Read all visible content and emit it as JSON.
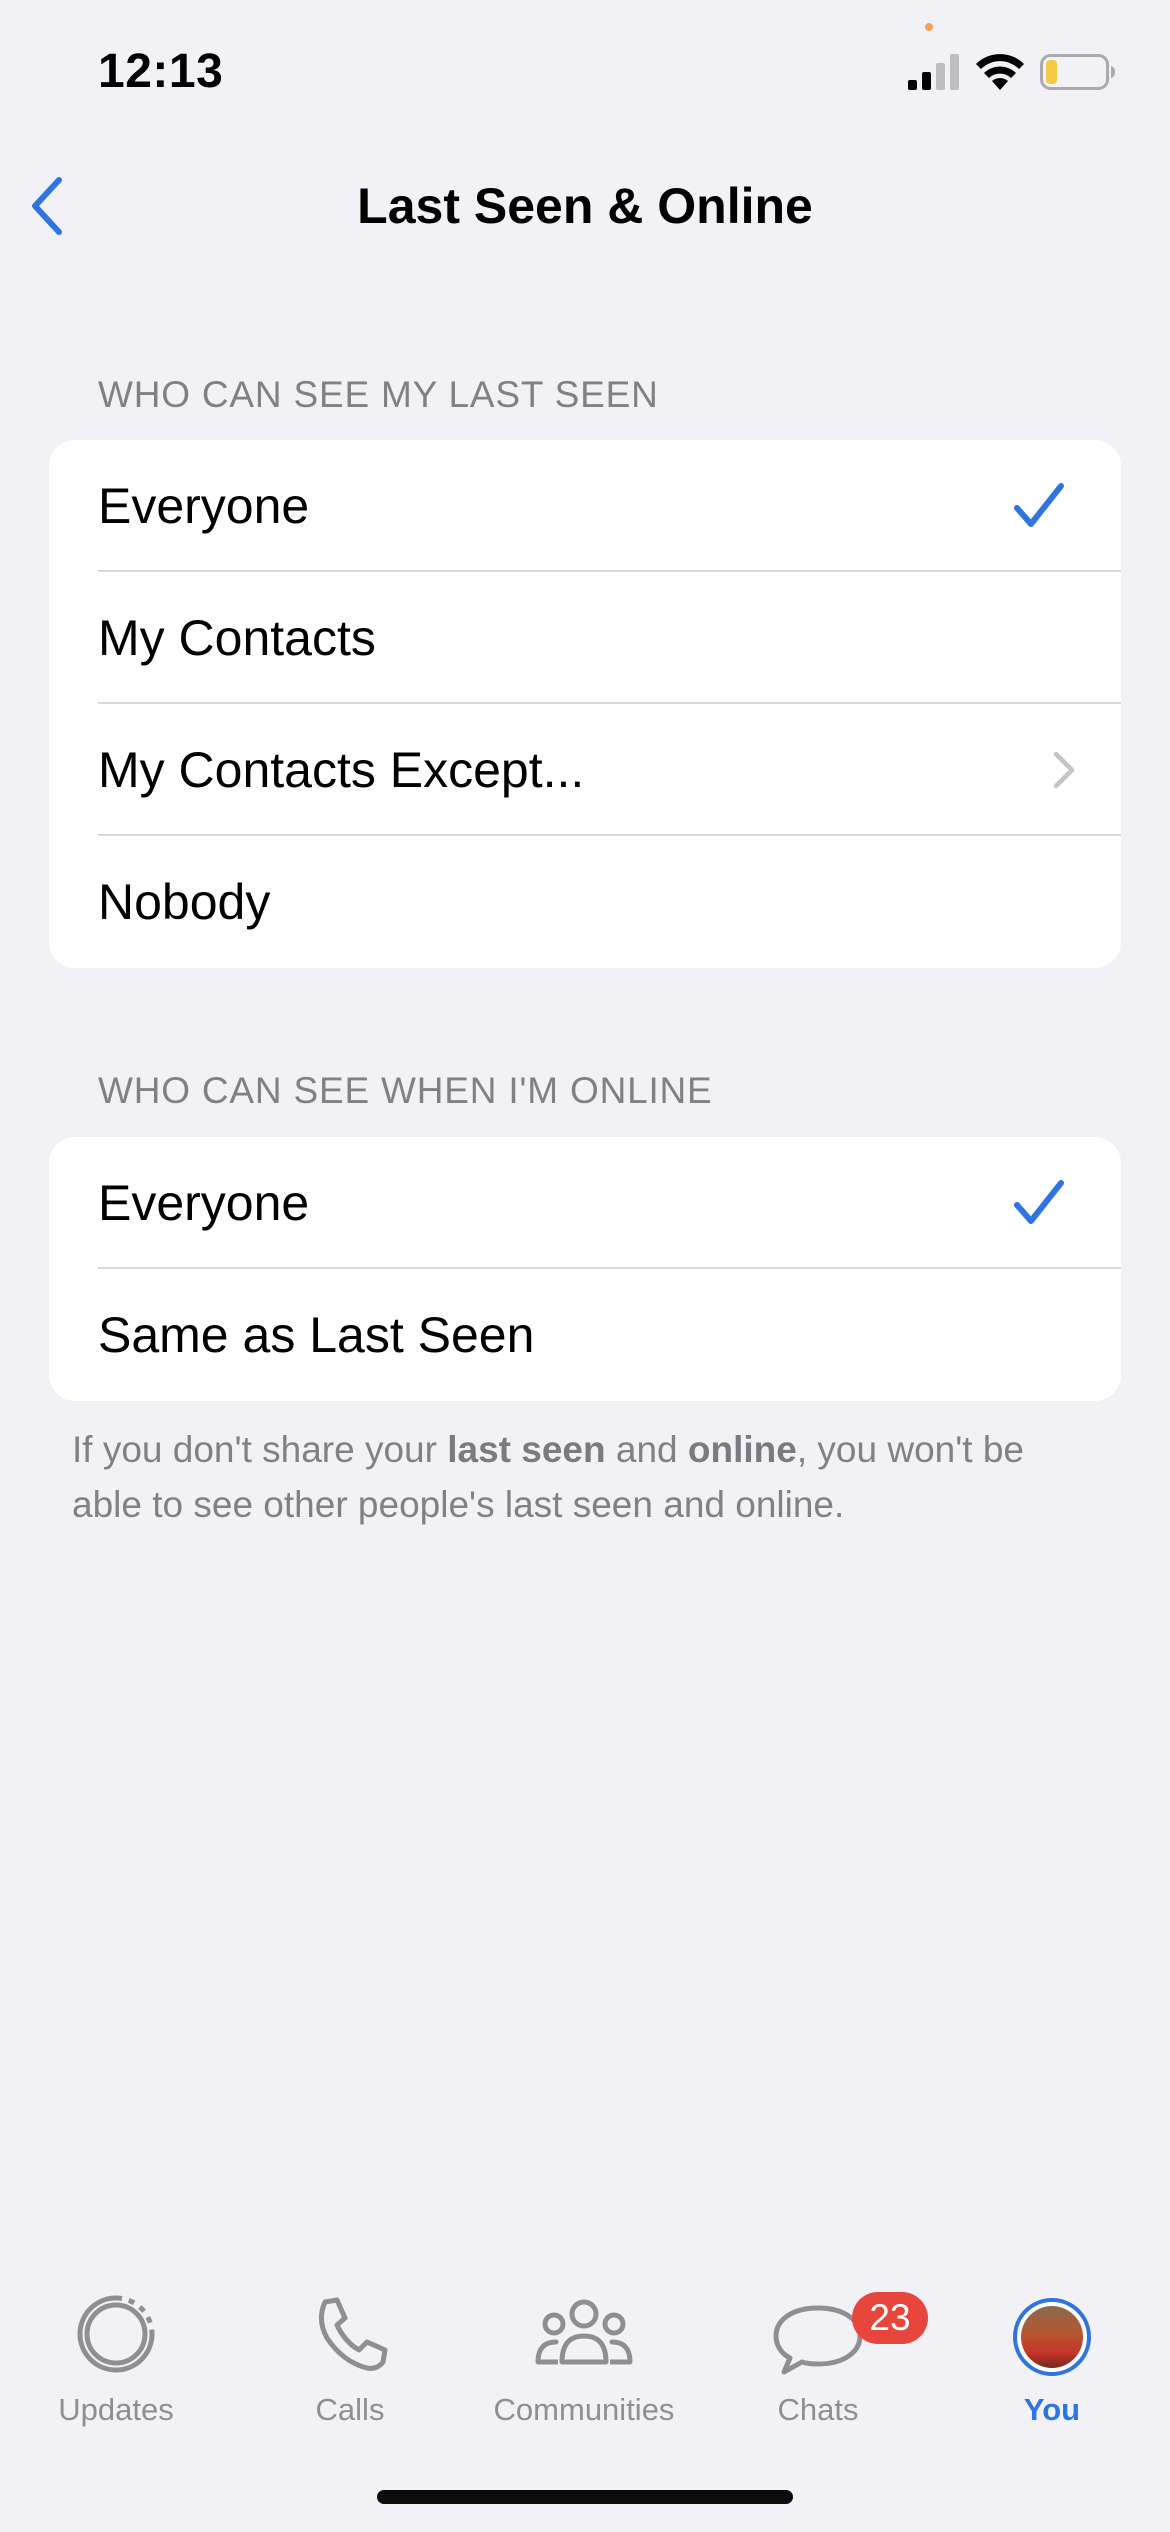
{
  "status_bar": {
    "time": "12:13",
    "signal_icon": "cellular-signal-icon",
    "wifi_icon": "wifi-icon",
    "battery_icon": "battery-low-icon",
    "battery_level": 0.2,
    "battery_color": "#f6c945"
  },
  "nav": {
    "title": "Last Seen & Online",
    "back_icon": "chevron-left-icon"
  },
  "sections": {
    "last_seen": {
      "header": "WHO CAN SEE MY LAST SEEN",
      "options": [
        {
          "label": "Everyone",
          "selected": true
        },
        {
          "label": "My Contacts",
          "selected": false
        },
        {
          "label": "My Contacts Except...",
          "selected": false,
          "has_chevron": true
        },
        {
          "label": "Nobody",
          "selected": false
        }
      ]
    },
    "online": {
      "header": "WHO CAN SEE WHEN I'M ONLINE",
      "options": [
        {
          "label": "Everyone",
          "selected": true
        },
        {
          "label": "Same as Last Seen",
          "selected": false
        }
      ]
    }
  },
  "footnote": {
    "part1": "If you don't share your ",
    "bold1": "last seen",
    "part2": " and ",
    "bold2": "online",
    "part3": ", you won't be able to see other people's last seen and online."
  },
  "tabs": [
    {
      "label": "Updates",
      "icon": "updates-icon",
      "active": false
    },
    {
      "label": "Calls",
      "icon": "phone-icon",
      "active": false
    },
    {
      "label": "Communities",
      "icon": "communities-icon",
      "active": false
    },
    {
      "label": "Chats",
      "icon": "chats-icon",
      "active": false,
      "badge": "23"
    },
    {
      "label": "You",
      "icon": "avatar",
      "active": true
    }
  ],
  "colors": {
    "accent": "#2f74e0",
    "background": "#f2f1f6",
    "badge": "#e8463d",
    "secondary_text": "#808086"
  }
}
